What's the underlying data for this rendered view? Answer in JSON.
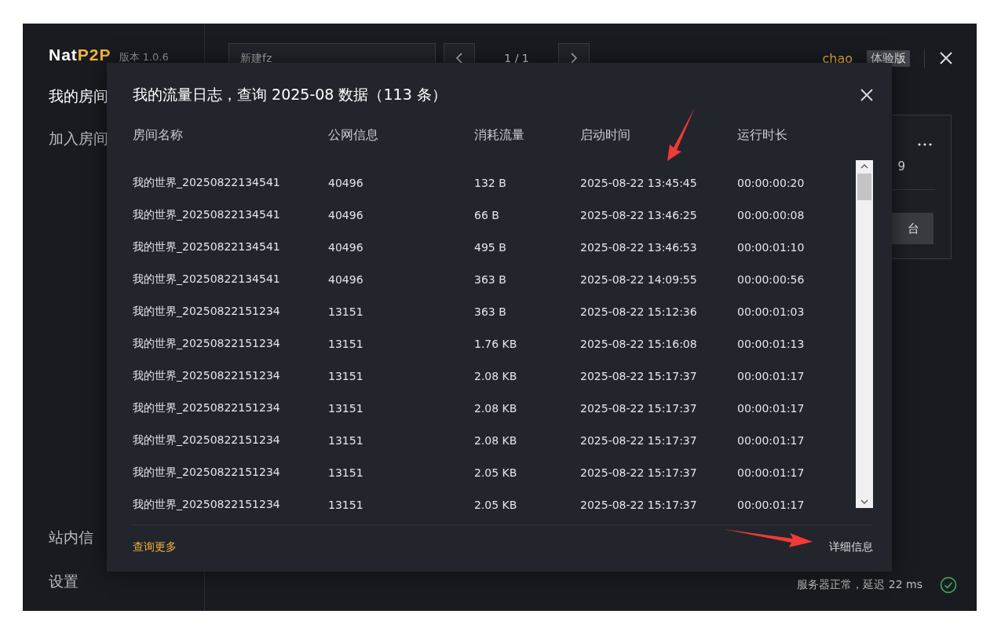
{
  "app": {
    "logo_primary": "Nat",
    "logo_accent": "P2P",
    "version": "版本 1.0.6"
  },
  "sidebar": {
    "items": [
      {
        "label": "我的房间",
        "selected": true
      },
      {
        "label": "加入房间",
        "selected": false
      }
    ],
    "bottom_items": [
      {
        "label": "站内信"
      },
      {
        "label": "设置"
      }
    ]
  },
  "toolbar": {
    "dropdown": "新建fz",
    "page": "1 / 1",
    "user": "chao",
    "badge": "体验版"
  },
  "background_card": {
    "partial_text": "9",
    "button": "台"
  },
  "status_bar": {
    "text": "服务器正常，延迟 22 ms",
    "ok": true
  },
  "dialog": {
    "title": "我的流量日志，查询 2025-08 数据（113 条）",
    "columns": [
      "房间名称",
      "公网信息",
      "消耗流量",
      "启动时间",
      "运行时长"
    ],
    "rows": [
      [
        "我的世界_20250822134541",
        "40496",
        "132 B",
        "2025-08-22 13:45:45",
        "00:00:00:20"
      ],
      [
        "我的世界_20250822134541",
        "40496",
        "66 B",
        "2025-08-22 13:46:25",
        "00:00:00:08"
      ],
      [
        "我的世界_20250822134541",
        "40496",
        "495 B",
        "2025-08-22 13:46:53",
        "00:00:01:10"
      ],
      [
        "我的世界_20250822134541",
        "40496",
        "363 B",
        "2025-08-22 14:09:55",
        "00:00:00:56"
      ],
      [
        "我的世界_20250822151234",
        "13151",
        "363 B",
        "2025-08-22 15:12:36",
        "00:00:01:03"
      ],
      [
        "我的世界_20250822151234",
        "13151",
        "1.76 KB",
        "2025-08-22 15:16:08",
        "00:00:01:13"
      ],
      [
        "我的世界_20250822151234",
        "13151",
        "2.08 KB",
        "2025-08-22 15:17:37",
        "00:00:01:17"
      ],
      [
        "我的世界_20250822151234",
        "13151",
        "2.08 KB",
        "2025-08-22 15:17:37",
        "00:00:01:17"
      ],
      [
        "我的世界_20250822151234",
        "13151",
        "2.08 KB",
        "2025-08-22 15:17:37",
        "00:00:01:17"
      ],
      [
        "我的世界_20250822151234",
        "13151",
        "2.05 KB",
        "2025-08-22 15:17:37",
        "00:00:01:17"
      ],
      [
        "我的世界_20250822151234",
        "13151",
        "2.05 KB",
        "2025-08-22 15:17:37",
        "00:00:01:17"
      ]
    ],
    "more_link": "查询更多",
    "details_link": "详细信息"
  }
}
